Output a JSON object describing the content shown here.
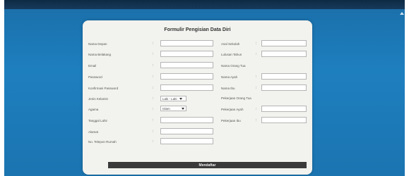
{
  "form": {
    "title": "Formulir Pengisian Data Diri",
    "submit_label": "Mendaftar"
  },
  "left_fields": [
    {
      "label": "Nama Depan"
    },
    {
      "label": "Nama Belakang"
    },
    {
      "label": "Email"
    },
    {
      "label": "Password"
    },
    {
      "label": "Konfirmasi Password"
    }
  ],
  "gender": {
    "label": "Jenis Kelamin",
    "value": "Laki - Laki"
  },
  "religion": {
    "label": "Agama",
    "value": "Islam"
  },
  "birth_date": {
    "label": "Tanggal Lahir"
  },
  "address": {
    "label": "Alamat"
  },
  "phone": {
    "label": "No. Telepon Rumah"
  },
  "right_fields": {
    "school": {
      "label": "Asal Sekolah"
    },
    "grad_year": {
      "label": "Lulusan Tahun"
    },
    "parents_heading": {
      "label": "Nama Orang Tua"
    },
    "father": {
      "label": "Nama Ayah"
    },
    "mother": {
      "label": "Nama Ibu"
    },
    "parents_job_heading": {
      "label": "Pekerjaan Orang Tua"
    },
    "father_job": {
      "label": "Pekerjaan Ayah"
    },
    "mother_job": {
      "label": "Pekerjaan Ibu"
    }
  },
  "colon": ":"
}
